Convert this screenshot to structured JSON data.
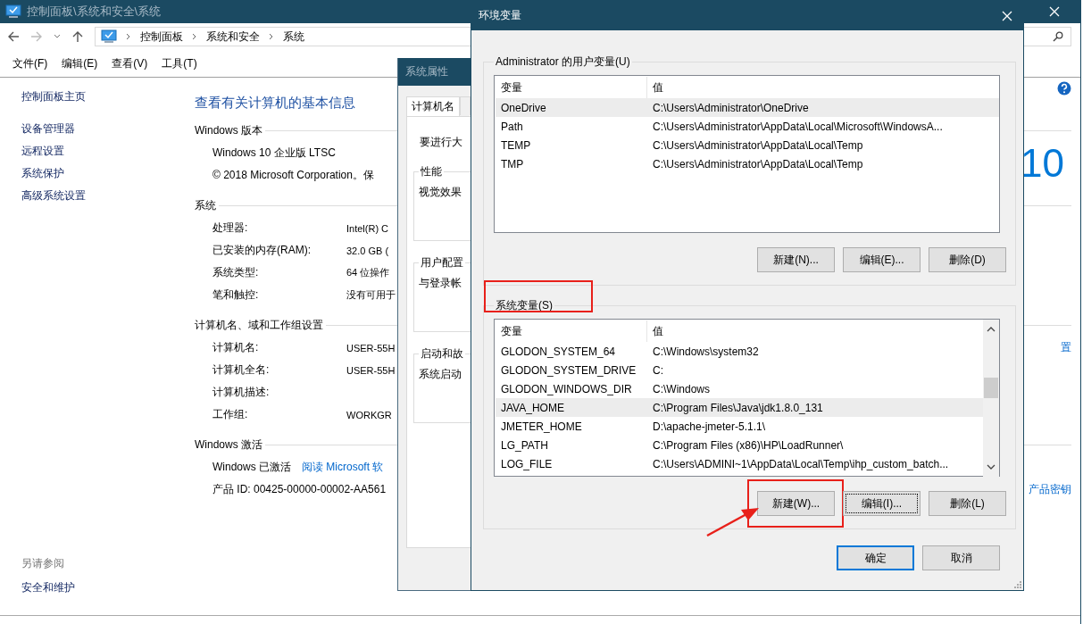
{
  "window": {
    "title": "控制面板\\系统和安全\\系统"
  },
  "address": {
    "crumbs": [
      "控制面板",
      "系统和安全",
      "系统"
    ]
  },
  "menu": [
    "文件(F)",
    "编辑(E)",
    "查看(V)",
    "工具(T)"
  ],
  "sidebar": {
    "items": [
      "控制面板主页",
      "设备管理器",
      "远程设置",
      "系统保护",
      "高级系统设置"
    ],
    "see_also": "另请参阅",
    "see_also_items": [
      "安全和维护"
    ]
  },
  "content": {
    "heading": "查看有关计算机的基本信息",
    "sections": [
      {
        "title": "Windows 版本",
        "logo": "10",
        "rows": [
          {
            "kind": "line",
            "text": "Windows 10 企业版 LTSC"
          },
          {
            "kind": "line",
            "text": "© 2018 Microsoft Corporation。保"
          }
        ]
      },
      {
        "title": "系统",
        "rows": [
          {
            "kind": "pair",
            "label": "处理器:",
            "value": "Intel(R) C"
          },
          {
            "kind": "pair",
            "label": "已安装的内存(RAM):",
            "value": "32.0 GB ("
          },
          {
            "kind": "pair",
            "label": "系统类型:",
            "value": "64 位操作"
          },
          {
            "kind": "pair",
            "label": "笔和触控:",
            "value": "没有可用于"
          }
        ]
      },
      {
        "title": "计算机名、域和工作组设置",
        "rows": [
          {
            "kind": "pair",
            "label": "计算机名:",
            "value": "USER-55H",
            "side_link": "置"
          },
          {
            "kind": "pair",
            "label": "计算机全名:",
            "value": "USER-55H"
          },
          {
            "kind": "pair",
            "label": "计算机描述:"
          },
          {
            "kind": "pair",
            "label": "工作组:",
            "value": "WORKGR"
          }
        ]
      },
      {
        "title": "Windows 激活",
        "rows": [
          {
            "kind": "activation",
            "text": "Windows 已激活",
            "link": "阅读 Microsoft 软"
          },
          {
            "kind": "line",
            "text": "产品 ID: 00425-00000-00002-AA561",
            "side_link": "产品密钥"
          }
        ]
      }
    ]
  },
  "system_properties": {
    "title": "系统属性",
    "tabs": [
      {
        "label": "计算机名",
        "selected": true
      }
    ],
    "intro": "要进行大",
    "groups": [
      {
        "title": "性能",
        "text": "视觉效果"
      },
      {
        "title": "用户配置",
        "text": "与登录帐"
      },
      {
        "title": "启动和故",
        "text": "系统启动"
      }
    ]
  },
  "env_dialog": {
    "title": "环境变量",
    "user_vars": {
      "label": "Administrator 的用户变量(U)",
      "columns": [
        "变量",
        "值"
      ],
      "rows": [
        {
          "name": "OneDrive",
          "value": "C:\\Users\\Administrator\\OneDrive",
          "selected": true
        },
        {
          "name": "Path",
          "value": "C:\\Users\\Administrator\\AppData\\Local\\Microsoft\\WindowsA...",
          "selected": false
        },
        {
          "name": "TEMP",
          "value": "C:\\Users\\Administrator\\AppData\\Local\\Temp",
          "selected": false
        },
        {
          "name": "TMP",
          "value": "C:\\Users\\Administrator\\AppData\\Local\\Temp",
          "selected": false
        }
      ],
      "buttons": [
        {
          "label": "新建(N)...",
          "highlighted": false,
          "focused": false
        },
        {
          "label": "编辑(E)...",
          "highlighted": false,
          "focused": false
        },
        {
          "label": "删除(D)",
          "highlighted": false,
          "focused": false
        }
      ]
    },
    "system_vars": {
      "label": "系统变量(S)",
      "label_highlighted": true,
      "columns": [
        "变量",
        "值"
      ],
      "scrollbar": true,
      "rows": [
        {
          "name": "GLODON_SYSTEM_64",
          "value": "C:\\Windows\\system32",
          "selected": false
        },
        {
          "name": "GLODON_SYSTEM_DRIVE",
          "value": "C:",
          "selected": false
        },
        {
          "name": "GLODON_WINDOWS_DIR",
          "value": "C:\\Windows",
          "selected": false
        },
        {
          "name": "JAVA_HOME",
          "value": "C:\\Program Files\\Java\\jdk1.8.0_131",
          "selected": true
        },
        {
          "name": "JMETER_HOME",
          "value": "D:\\apache-jmeter-5.1.1\\",
          "selected": false
        },
        {
          "name": "LG_PATH",
          "value": "C:\\Program Files (x86)\\HP\\LoadRunner\\",
          "selected": false
        },
        {
          "name": "LOG_FILE",
          "value": "C:\\Users\\ADMINI~1\\AppData\\Local\\Temp\\ihp_custom_batch...",
          "selected": false
        }
      ],
      "buttons": [
        {
          "label": "新建(W)...",
          "highlighted": true,
          "focused": false
        },
        {
          "label": "编辑(I)...",
          "highlighted": false,
          "focused": true
        },
        {
          "label": "删除(L)",
          "highlighted": false,
          "focused": false
        }
      ]
    },
    "buttons": [
      {
        "label": "确定",
        "default": true
      },
      {
        "label": "取消",
        "default": false
      }
    ]
  }
}
